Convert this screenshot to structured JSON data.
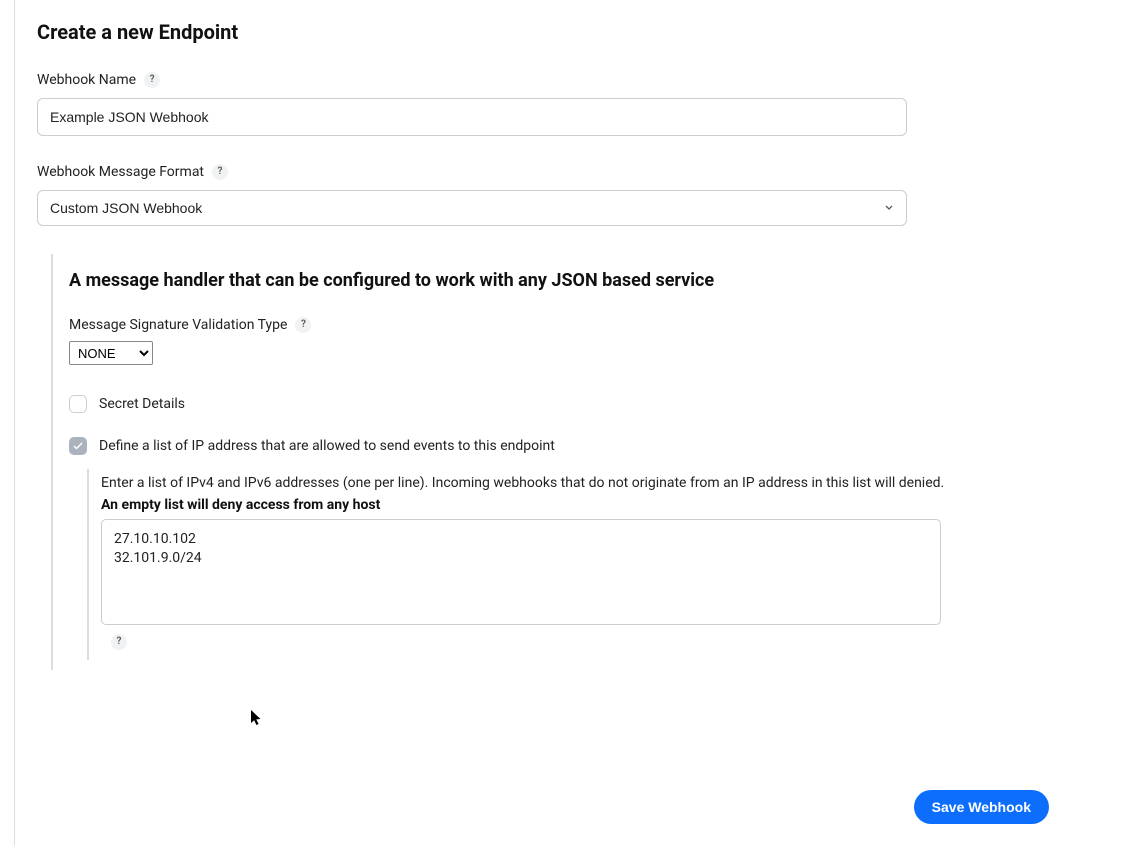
{
  "heading": "Create a new Endpoint",
  "webhook_name": {
    "label": "Webhook Name",
    "value": "Example JSON Webhook"
  },
  "webhook_format": {
    "label": "Webhook Message Format",
    "selected": "Custom JSON Webhook"
  },
  "handler": {
    "description": "A message handler that can be configured to work with any JSON based service",
    "sig_validation": {
      "label": "Message Signature Validation Type",
      "selected": "NONE"
    },
    "secret_details": {
      "label": "Secret Details",
      "checked": false
    },
    "ip_allowlist": {
      "label": "Define a list of IP address that are allowed to send events to this endpoint",
      "checked": true,
      "description": "Enter a list of IPv4 and IPv6 addresses (one per line). Incoming webhooks that do not originate from an IP address in this list will denied.",
      "warning": "An empty list will deny access from any host",
      "value": "27.10.10.102\n32.101.9.0/24"
    }
  },
  "save_button": "Save Webhook",
  "help_glyph": "?"
}
